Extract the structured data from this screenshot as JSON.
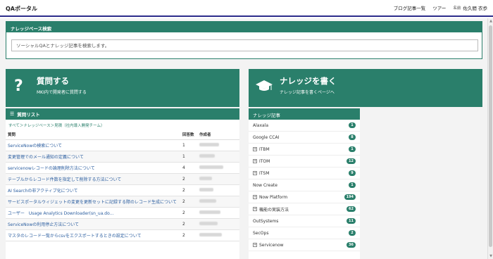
{
  "header": {
    "title": "QAポータル",
    "nav": [
      "ブログ記事一覧",
      "ツアー"
    ],
    "user_label": "名前",
    "user_name": "佐久間 衣歩"
  },
  "search": {
    "heading": "ナレッジベース検索",
    "placeholder": "ソーシャルQAとナレッジ記事を検索します。"
  },
  "ask": {
    "icon": "question-icon",
    "title": "質問する",
    "subtitle": "MKI内で開発者に質問する"
  },
  "knowledge": {
    "icon": "graduation-cap-icon",
    "title": "ナレッジを書く",
    "subtitle": "ナレッジ記事を書くページへ"
  },
  "questions": {
    "heading": "質問リスト",
    "breadcrumb": "すべて＞ナレッジベース＞見積（社内導入開発チーム）",
    "columns": [
      "質問",
      "回答数",
      "作成者"
    ],
    "rows": [
      {
        "title": "ServiceNowの検索について",
        "count": "1"
      },
      {
        "title": "変更管理でのメール通知の定義について",
        "count": "1"
      },
      {
        "title": "servicenowレコードの論理削除方法について",
        "count": "4"
      },
      {
        "title": "テーブルからレコード件数を指定して削除する方法について",
        "count": "2"
      },
      {
        "title": "AI Searchの非アクティブ化について",
        "count": "2"
      },
      {
        "title": "サービスポータルウィジェットの変更を更新セットに記録する際のレコード生成について",
        "count": "2"
      },
      {
        "title": "ユーザー　Usage Analytics Downloader(sn_ua.do...",
        "count": "2"
      },
      {
        "title": "ServiceNowの利用停止方法について",
        "count": "2"
      },
      {
        "title": "マスタのレコード一覧からcsvをエクスポートするときの設定について",
        "count": "2"
      }
    ]
  },
  "articles": {
    "heading": "ナレッジ記事",
    "items": [
      {
        "name": "Alaxala",
        "count": "1",
        "expandable": false
      },
      {
        "name": "Google CCAI",
        "count": "8",
        "expandable": false
      },
      {
        "name": "ITBM",
        "count": "1",
        "expandable": true
      },
      {
        "name": "ITOM",
        "count": "12",
        "expandable": true
      },
      {
        "name": "ITSM",
        "count": "9",
        "expandable": true
      },
      {
        "name": "Now Create",
        "count": "1",
        "expandable": false
      },
      {
        "name": "Now Platform",
        "count": "194",
        "expandable": true
      },
      {
        "name": "機能の実装方法",
        "count": "62",
        "expandable": true
      },
      {
        "name": "OutSystems",
        "count": "11",
        "expandable": false
      },
      {
        "name": "SecOps",
        "count": "2",
        "expandable": false
      },
      {
        "name": "Servicenow",
        "count": "36",
        "expandable": true
      }
    ]
  },
  "colors": {
    "accent": "#2a7f6b",
    "header_border": "#2c2c8a",
    "link": "#2a5d9f"
  }
}
